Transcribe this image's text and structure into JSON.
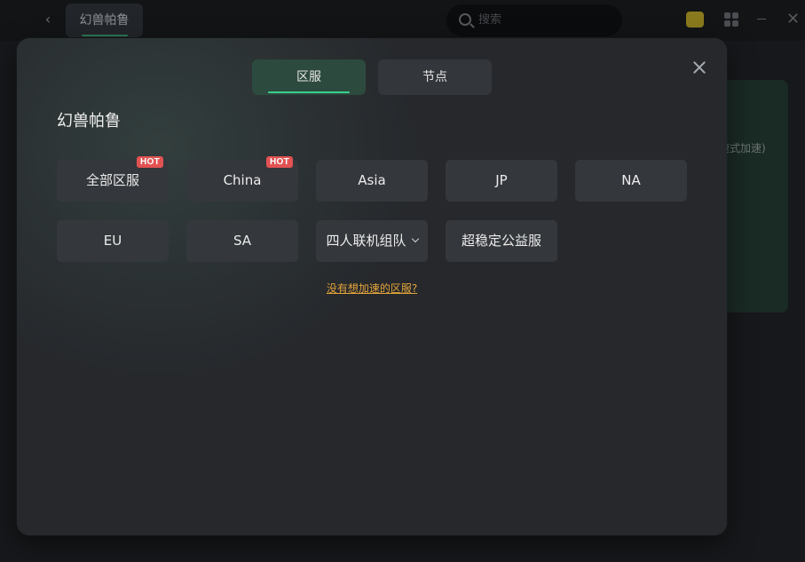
{
  "background": {
    "tab_label": "幻兽帕鲁",
    "search_placeholder": "搜索",
    "card_partial_text": "速式加速)",
    "back_icon": "chevron-left-icon",
    "close_icon": "close-icon"
  },
  "modal": {
    "tabs": [
      {
        "label": "区服",
        "active": true
      },
      {
        "label": "节点",
        "active": false
      }
    ],
    "game_title": "幻兽帕鲁",
    "regions": [
      {
        "label": "全部区服",
        "badge": "HOT"
      },
      {
        "label": "China",
        "badge": "HOT"
      },
      {
        "label": "Asia"
      },
      {
        "label": "JP"
      },
      {
        "label": "NA"
      },
      {
        "label": "EU"
      },
      {
        "label": "SA"
      },
      {
        "label": "四人联机组队",
        "dropdown": true
      },
      {
        "label": "超稳定公益服"
      }
    ],
    "missing_region_link": "没有想加速的区服?"
  },
  "colors": {
    "accent": "#3ccf8e",
    "hot_badge": "#e25252",
    "link": "#e2a33a",
    "modal_bg": "#26282c",
    "button_bg": "#34373b"
  }
}
